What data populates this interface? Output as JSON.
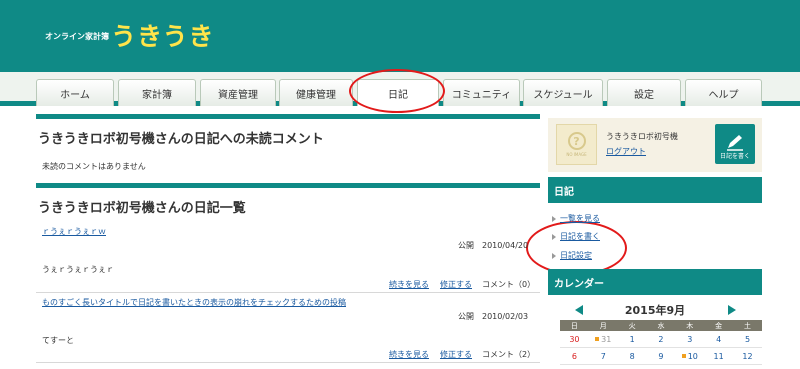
{
  "header": {
    "logo_small": "オンライン家計簿",
    "logo_big": "うきうき"
  },
  "nav": {
    "tabs": [
      {
        "label": "ホーム"
      },
      {
        "label": "家計簿"
      },
      {
        "label": "資産管理"
      },
      {
        "label": "健康管理"
      },
      {
        "label": "日記"
      },
      {
        "label": "コミュニティ"
      },
      {
        "label": "スケジュール"
      },
      {
        "label": "設定"
      },
      {
        "label": "ヘルプ"
      }
    ],
    "active": "日記"
  },
  "main": {
    "unread_title": "うきうきロボ初号機さんの日記への未読コメント",
    "unread_empty": "未読のコメントはありません",
    "list_title": "うきうきロボ初号機さんの日記一覧",
    "entries": [
      {
        "title": "ｒうぇｒうぇｒｗ",
        "date": "公開　2010/04/20",
        "body": "うぇｒうぇｒうぇｒ",
        "read_more": "続きを見る",
        "edit": "修正する",
        "comments": "コメント（0）"
      },
      {
        "title": "ものすごく長いタイトルで日記を書いたときの表示の崩れをチェックするための投稿",
        "date": "公開　2010/02/03",
        "body": "てすーと",
        "read_more": "続きを見る",
        "edit": "修正する",
        "comments": "コメント（2）"
      }
    ]
  },
  "sidebar": {
    "no_image_text": "NO IMAGE",
    "no_image_glyph": "?",
    "user_name": "うきうきロボ初号機",
    "logout": "ログアウト",
    "write_button": "日記を書く",
    "diary_head": "日記",
    "diary_links": [
      {
        "label": "一覧を見る"
      },
      {
        "label": "日記を書く"
      },
      {
        "label": "日記設定"
      }
    ],
    "calendar_head": "カレンダー",
    "calendar": {
      "title": "2015年9月",
      "dow": [
        "日",
        "月",
        "火",
        "水",
        "木",
        "金",
        "土"
      ],
      "week1": [
        "30",
        "31",
        "1",
        "2",
        "3",
        "4",
        "5"
      ],
      "week2": [
        "6",
        "7",
        "8",
        "9",
        "10",
        "11",
        "12"
      ]
    }
  },
  "colors": {
    "brand": "#0f8a86",
    "logo": "#ffe44a",
    "link": "#1a5aa0",
    "highlight": "#e21a1a"
  }
}
